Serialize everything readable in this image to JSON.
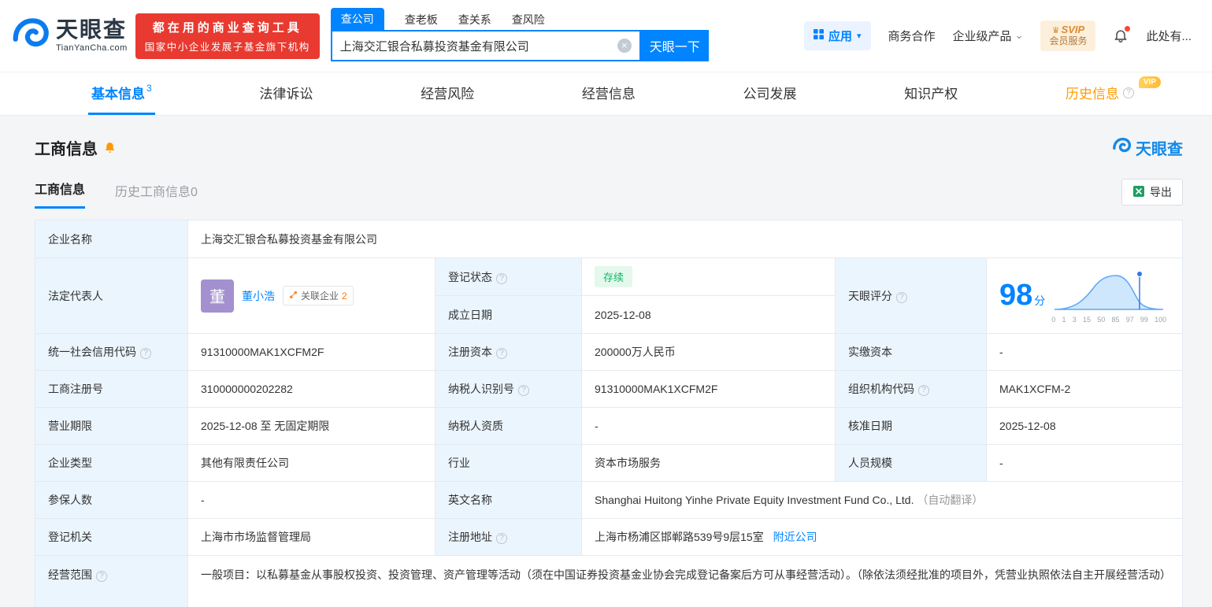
{
  "header": {
    "logo_text": "天眼查",
    "logo_sub": "TianYanCha.com",
    "promo_line1": "都在用的商业查询工具",
    "promo_line2": "国家中小企业发展子基金旗下机构",
    "search_tabs": [
      "查公司",
      "查老板",
      "查关系",
      "查风险"
    ],
    "search_value": "上海交汇银合私募投资基金有限公司",
    "search_button": "天眼一下",
    "apps_label": "应用",
    "biz_coop": "商务合作",
    "enterprise": "企业级产品",
    "svip_top": "SVIP",
    "svip_bottom": "会员服务",
    "username": "此处有..."
  },
  "nav": {
    "tabs": [
      {
        "label": "基本信息",
        "count": "3"
      },
      {
        "label": "法律诉讼"
      },
      {
        "label": "经营风险"
      },
      {
        "label": "经营信息"
      },
      {
        "label": "公司发展"
      },
      {
        "label": "知识产权"
      },
      {
        "label": "历史信息",
        "badge": "VIP"
      }
    ]
  },
  "section": {
    "title": "工商信息",
    "watermark": "天眼查",
    "sub_tabs": [
      "工商信息",
      "历史工商信息0"
    ],
    "export_label": "导出"
  },
  "biz": {
    "company_name_label": "企业名称",
    "company_name": "上海交汇银合私募投资基金有限公司",
    "legal_rep_label": "法定代表人",
    "avatar_char": "董",
    "legal_rep_name": "董小浩",
    "related_label": "关联企业",
    "related_count": "2",
    "reg_status_label": "登记状态",
    "reg_status_value": "存续",
    "establish_label": "成立日期",
    "establish_value": "2025-12-08",
    "score_label": "天眼评分",
    "score_value": "98",
    "score_unit": "分",
    "score_axis": [
      "0",
      "1",
      "3",
      "15",
      "50",
      "85",
      "97",
      "99",
      "100"
    ],
    "uscc_label": "统一社会信用代码",
    "uscc_value": "91310000MAK1XCFM2F",
    "reg_capital_label": "注册资本",
    "reg_capital_value": "200000万人民币",
    "paid_capital_label": "实缴资本",
    "paid_capital_value": "-",
    "reg_no_label": "工商注册号",
    "reg_no_value": "310000000202282",
    "taxpayer_id_label": "纳税人识别号",
    "taxpayer_id_value": "91310000MAK1XCFM2F",
    "org_code_label": "组织机构代码",
    "org_code_value": "MAK1XCFM-2",
    "term_label": "营业期限",
    "term_value": "2025-12-08 至 无固定期限",
    "taxpayer_qual_label": "纳税人资质",
    "taxpayer_qual_value": "-",
    "approval_date_label": "核准日期",
    "approval_date_value": "2025-12-08",
    "company_type_label": "企业类型",
    "company_type_value": "其他有限责任公司",
    "industry_label": "行业",
    "industry_value": "资本市场服务",
    "staff_size_label": "人员规模",
    "staff_size_value": "-",
    "insured_label": "参保人数",
    "insured_value": "-",
    "english_name_label": "英文名称",
    "english_name_value": "Shanghai Huitong Yinhe Private Equity Investment Fund Co., Ltd.",
    "english_name_note": "（自动翻译）",
    "reg_authority_label": "登记机关",
    "reg_authority_value": "上海市市场监督管理局",
    "address_label": "注册地址",
    "address_value": "上海市杨浦区邯郸路539号9层15室",
    "address_link": "附近公司",
    "scope_label": "经营范围",
    "scope_value": "一般项目：以私募基金从事股权投资、投资管理、资产管理等活动（须在中国证券投资基金业协会完成登记备案后方可从事经营活动）。（除依法须经批准的项目外，凭营业执照依法自主开展经营活动）"
  },
  "icons": {
    "help": "?",
    "clear": "×",
    "caret_down": "▾",
    "chevron_down": "⌄",
    "crown": "♛"
  },
  "colors": {
    "brand_blue": "#0084ff",
    "banner_red": "#e83a30",
    "label_bg": "#ebf5fe",
    "status_green": "#0fb86b",
    "history_orange": "#ff9c00"
  }
}
